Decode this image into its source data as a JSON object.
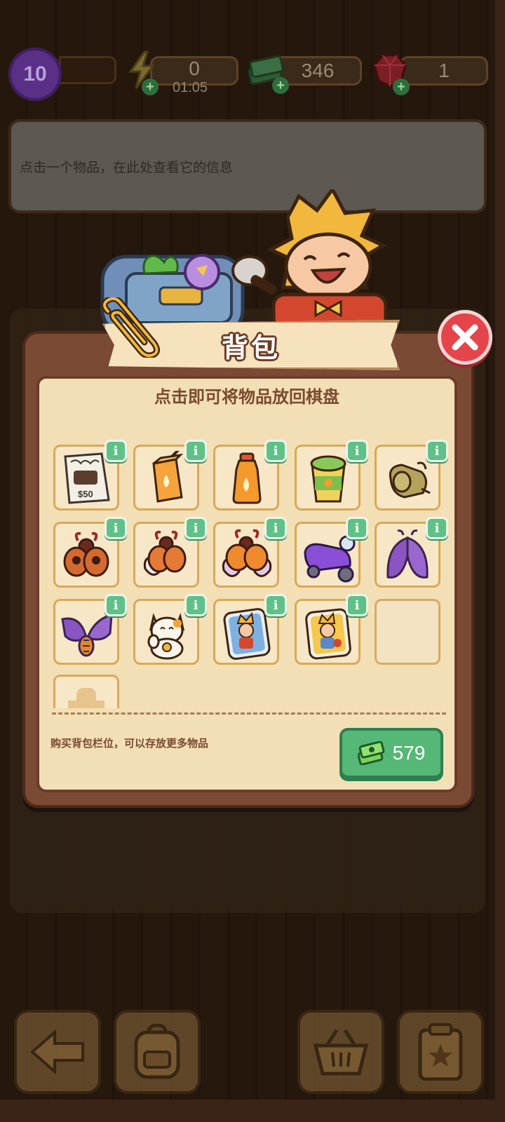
{
  "top_bar": {
    "level": "10",
    "energy": {
      "value": "0",
      "timer": "01:05"
    },
    "cash": {
      "value": "346"
    },
    "gems": {
      "value": "1"
    }
  },
  "info_box": {
    "text": "点击一个物品，在此处查看它的信息"
  },
  "dialog": {
    "title": "背包",
    "hint": "点击即可将物品放回棋盘",
    "info_badge_label": "i",
    "items": [
      {
        "icon": "cash-ticket-icon"
      },
      {
        "icon": "juice-box-icon"
      },
      {
        "icon": "juice-bottle-icon"
      },
      {
        "icon": "canned-food-icon"
      },
      {
        "icon": "rolled-cloth-icon"
      },
      {
        "icon": "beetle-small-icon"
      },
      {
        "icon": "beetle-wings-icon"
      },
      {
        "icon": "beetle-large-icon"
      },
      {
        "icon": "purple-scooter-icon"
      },
      {
        "icon": "purple-moth-icon"
      },
      {
        "icon": "purple-butterfly-icon"
      },
      {
        "icon": "lucky-cat-icon"
      },
      {
        "icon": "character-sticker-blue-icon"
      },
      {
        "icon": "character-sticker-yellow-icon"
      }
    ],
    "empty_slot_count": 1,
    "buy_slot_text": "购买背包栏位，可以存放更多物品",
    "buy_slot_price": "579"
  },
  "bottom_bar": {
    "buttons": [
      "back-arrow-icon",
      "backpack-icon",
      "basket-icon",
      "clipboard-icon"
    ]
  },
  "colors": {
    "close_button": "#e5444b",
    "buy_button": "#55b876",
    "info_badge": "#60c187",
    "panel_bg": "#f3dfb5"
  }
}
